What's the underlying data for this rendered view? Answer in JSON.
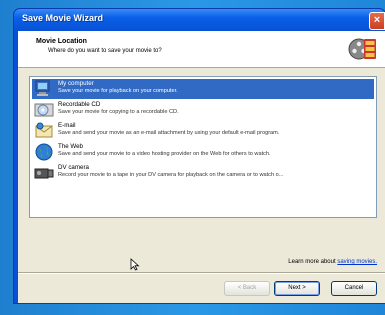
{
  "window": {
    "title": "Save Movie Wizard",
    "close_label": "×"
  },
  "header": {
    "title": "Movie Location",
    "subtitle": "Where do you want to save your movie to?",
    "icon": "film-reel-icon"
  },
  "options": [
    {
      "name": "My computer",
      "desc": "Save your movie for playback on your computer.",
      "icon": "computer-icon",
      "selected": true
    },
    {
      "name": "Recordable CD",
      "desc": "Save your movie for copying to a recordable CD.",
      "icon": "cd-icon",
      "selected": false
    },
    {
      "name": "E-mail",
      "desc": "Save and send your movie as an e-mail attachment by using your default e-mail program.",
      "icon": "email-icon",
      "selected": false
    },
    {
      "name": "The Web",
      "desc": "Save and send your movie to a video hosting provider on the Web for others to watch.",
      "icon": "globe-icon",
      "selected": false
    },
    {
      "name": "DV camera",
      "desc": "Record your movie to a tape in your DV camera for playback on the camera or to watch o...",
      "icon": "camcorder-icon",
      "selected": false
    }
  ],
  "footer": {
    "learn_prefix": "Learn more about ",
    "learn_link": "saving movies.",
    "back_label": "< Back",
    "next_label": "Next >",
    "cancel_label": "Cancel"
  },
  "colors": {
    "titlebar": "#0a5fe8",
    "selection": "#316ac5",
    "desktop": "#2a8fd9"
  }
}
